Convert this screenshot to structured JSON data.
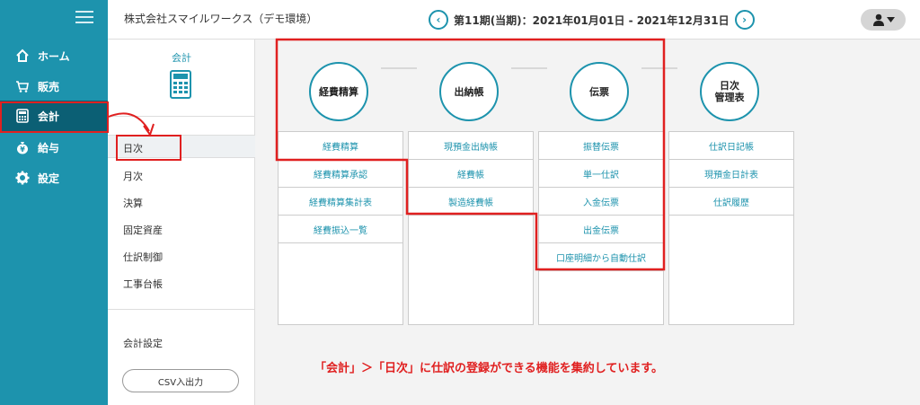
{
  "nav": {
    "items": [
      {
        "label": "ホーム",
        "icon": "home-icon"
      },
      {
        "label": "販売",
        "icon": "cart-icon"
      },
      {
        "label": "会計",
        "icon": "calculator-icon"
      },
      {
        "label": "給与",
        "icon": "money-bag-icon"
      },
      {
        "label": "設定",
        "icon": "gear-icon"
      }
    ]
  },
  "header": {
    "company": "株式会社スマイルワークス（デモ環境）",
    "period": "第11期(当期)：2021年01月01日 - 2021年12月31日",
    "prev_label": "‹",
    "next_label": "›"
  },
  "submenu": {
    "title": "会計",
    "items": [
      "日次",
      "月次",
      "決算",
      "固定資産",
      "仕訳制御",
      "工事台帳"
    ],
    "settings": "会計設定",
    "csv": "CSV入出力"
  },
  "columns": [
    {
      "title": "経費精算",
      "rows": [
        "経費精算",
        "経費精算承認",
        "経費精算集計表",
        "経費振込一覧"
      ]
    },
    {
      "title": "出納帳",
      "rows": [
        "現預金出納帳",
        "経費帳",
        "製造経費帳"
      ]
    },
    {
      "title": "伝票",
      "rows": [
        "振替伝票",
        "単一仕訳",
        "入金伝票",
        "出金伝票",
        "口座明細から自動仕訳"
      ]
    },
    {
      "title_line1": "日次",
      "title_line2": "管理表",
      "rows": [
        "仕訳日記帳",
        "現預金日計表",
        "仕訳履歴"
      ]
    }
  ],
  "caption": "「会計」＞「日次」に仕訳の登録ができる機能を集約しています。",
  "colors": {
    "nav": "#1d93ad",
    "nav_active": "#0b5f74",
    "accent": "#1d93ad",
    "annotation": "#e02020"
  }
}
